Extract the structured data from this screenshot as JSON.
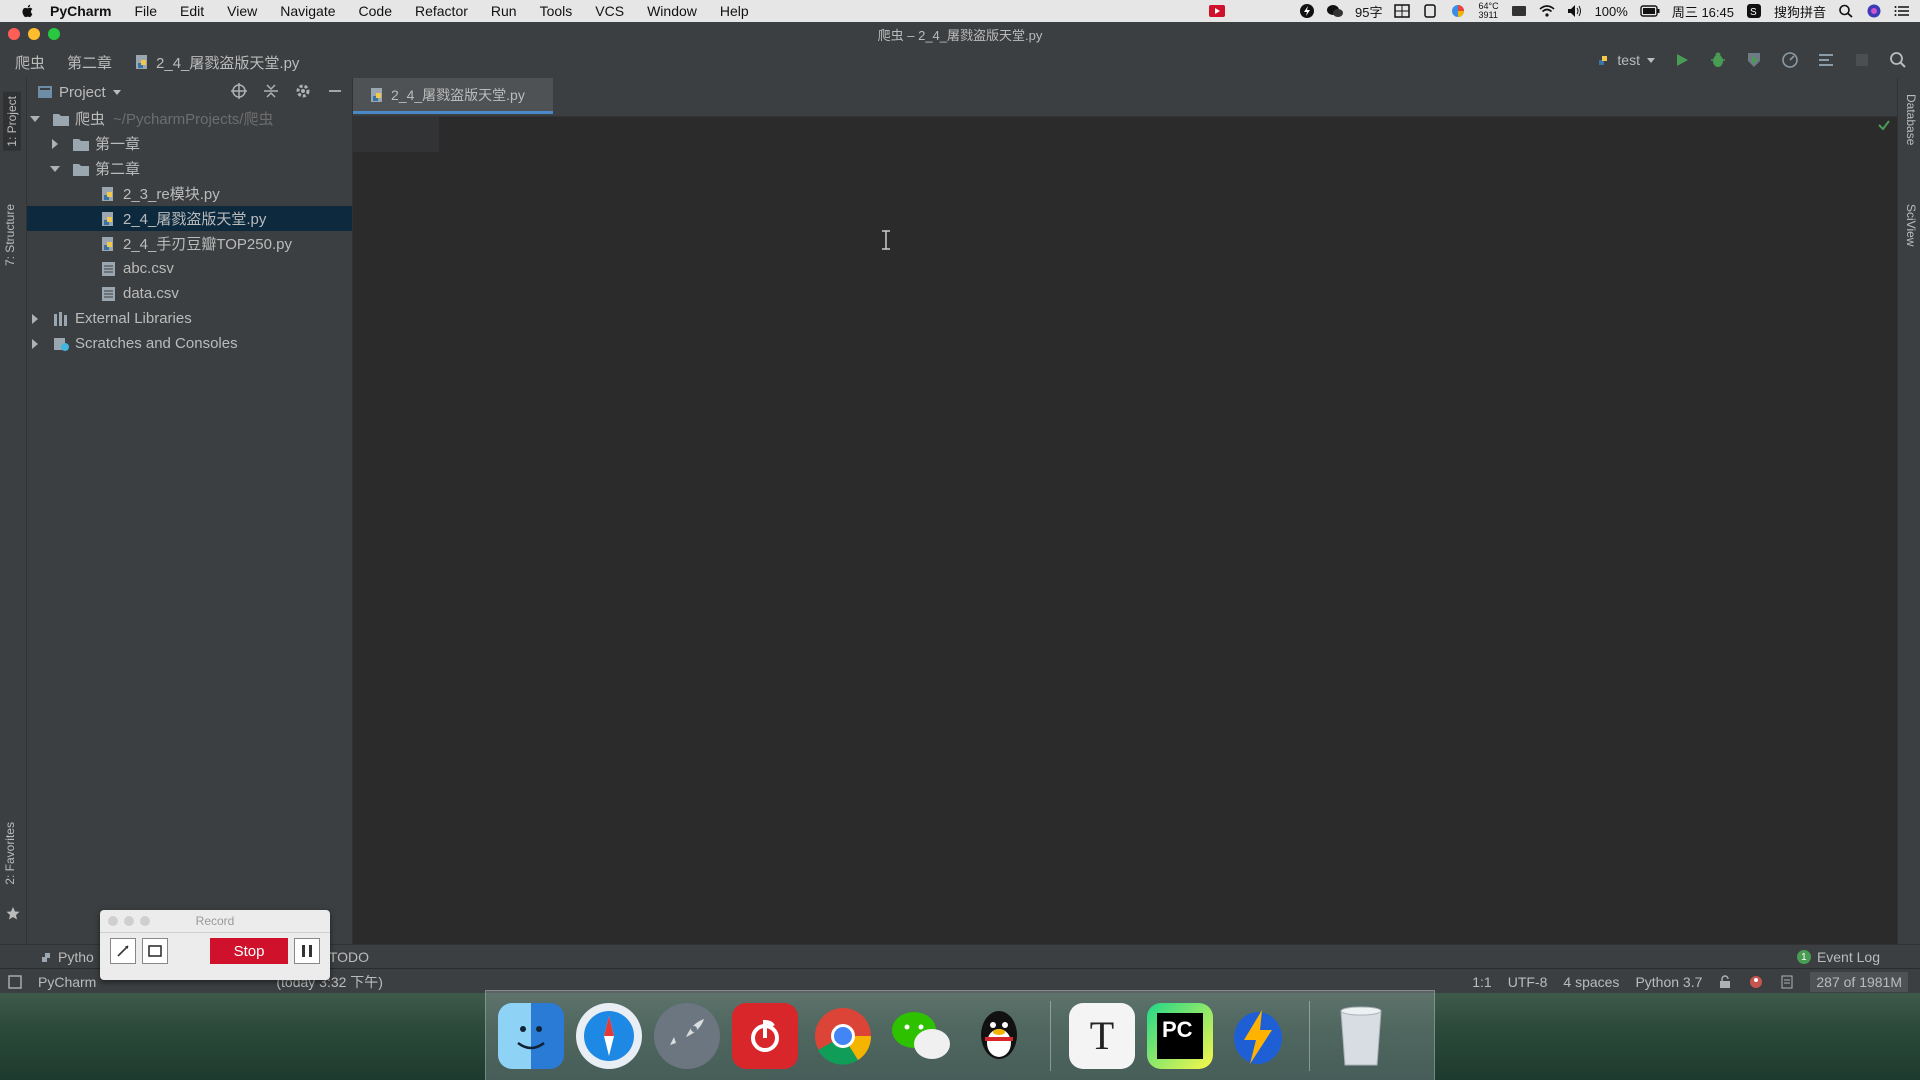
{
  "menubar": {
    "app": "PyCharm",
    "items": [
      "File",
      "Edit",
      "View",
      "Navigate",
      "Code",
      "Refactor",
      "Run",
      "Tools",
      "VCS",
      "Window",
      "Help"
    ],
    "status": {
      "input_count": "95字",
      "temp": "64°C",
      "temp_sub": "3911",
      "battery": "100%",
      "clock": "周三 16:45",
      "ime": "搜狗拼音"
    }
  },
  "window": {
    "title": "爬虫 – 2_4_屠戮盗版天堂.py"
  },
  "navbar": {
    "crumb_project": "爬虫",
    "crumb_folder": "第二章",
    "crumb_file": "2_4_屠戮盗版天堂.py",
    "run_config": "test"
  },
  "tool_tabs": {
    "project": "1: Project",
    "structure": "7: Structure",
    "favorites": "2: Favorites",
    "database": "Database",
    "sciview": "SciView"
  },
  "project_panel": {
    "title": "Project",
    "tree": [
      {
        "label": "爬虫",
        "suffix": "~/PycharmProjects/爬虫",
        "kind": "folder",
        "depth": 0,
        "expanded": true
      },
      {
        "label": "第一章",
        "kind": "folder",
        "depth": 1,
        "expanded": false
      },
      {
        "label": "第二章",
        "kind": "folder",
        "depth": 1,
        "expanded": true
      },
      {
        "label": "2_3_re模块.py",
        "kind": "py",
        "depth": 2
      },
      {
        "label": "2_4_屠戮盗版天堂.py",
        "kind": "py",
        "depth": 2,
        "selected": true
      },
      {
        "label": "2_4_手刃豆瓣TOP250.py",
        "kind": "py",
        "depth": 2
      },
      {
        "label": "abc.csv",
        "kind": "csv",
        "depth": 2
      },
      {
        "label": "data.csv",
        "kind": "csv",
        "depth": 2
      },
      {
        "label": "External Libraries",
        "kind": "lib",
        "depth": 0,
        "expanded": false
      },
      {
        "label": "Scratches and Consoles",
        "kind": "scratch",
        "depth": 0,
        "expanded": false
      }
    ]
  },
  "editor": {
    "tab_label": "2_4_屠戮盗版天堂.py"
  },
  "bottom_bar": {
    "python_console": "Pytho",
    "todo": "TODO",
    "event_log_count": "1",
    "event_log": "Event Log"
  },
  "status_bar": {
    "message": "PyCharm",
    "message_tail": "(today 3:32 下午)",
    "position": "1:1",
    "encoding": "UTF-8",
    "indent": "4 spaces",
    "interpreter": "Python 3.7",
    "memory": "287 of 1981M"
  },
  "recorder": {
    "title": "Record",
    "stop_label": "Stop"
  },
  "dock": {
    "apps": [
      "Finder",
      "Safari",
      "Launchpad",
      "NetEase Music",
      "Chrome",
      "WeChat",
      "QQ",
      "Typora",
      "PyCharm",
      "Thunder",
      "Trash"
    ],
    "pycharm_label": "PC",
    "typora_label": "T"
  },
  "colors": {
    "ide_bg": "#3c3f41",
    "editor_bg": "#2b2b2b",
    "selection": "#0d293e",
    "run_green": "#499c54",
    "accent_blue": "#4a88c7",
    "stop_red": "#d0112b"
  }
}
